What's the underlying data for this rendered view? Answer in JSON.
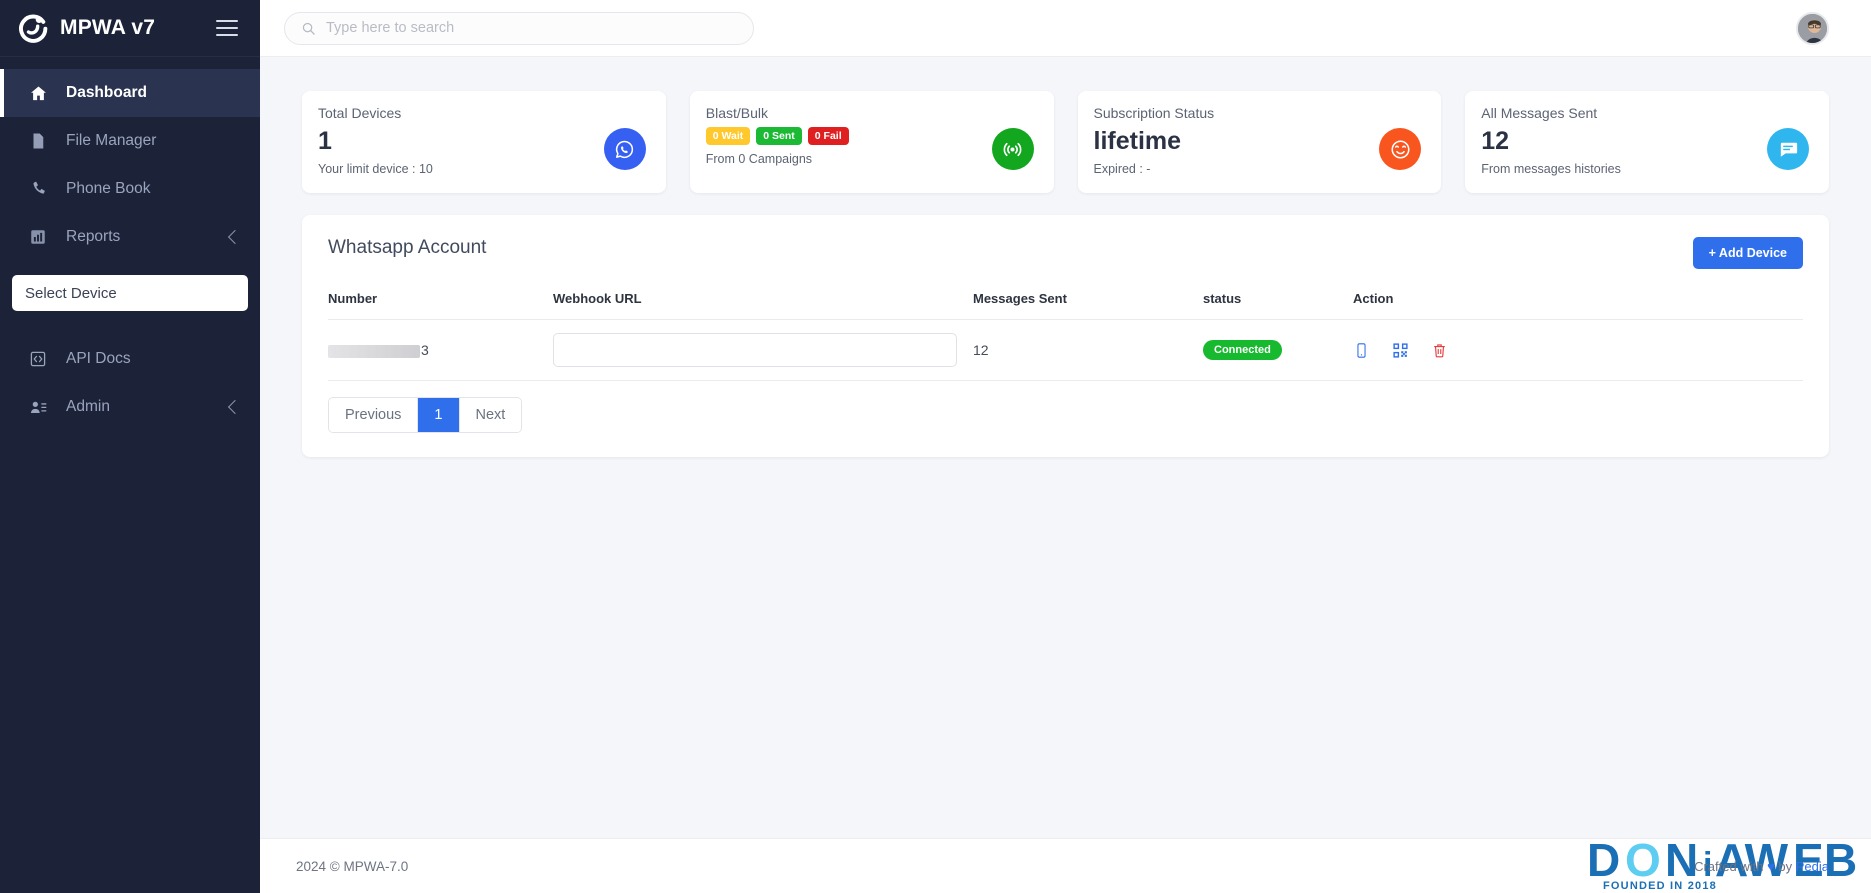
{
  "brand": {
    "name": "MPWA v7",
    "logo_icon": "mpwa-logo-icon",
    "menu_icon": "hamburger-icon"
  },
  "sidebar": {
    "items": [
      {
        "label": "Dashboard",
        "icon": "home-icon",
        "active": true,
        "chevron": false
      },
      {
        "label": "File Manager",
        "icon": "file-icon",
        "active": false,
        "chevron": false
      },
      {
        "label": "Phone Book",
        "icon": "phone-icon",
        "active": false,
        "chevron": false
      },
      {
        "label": "Reports",
        "icon": "bar-chart-icon",
        "active": false,
        "chevron": true
      }
    ],
    "device_select": {
      "label": "Select Device"
    },
    "items_bottom": [
      {
        "label": "API Docs",
        "icon": "code-brackets-icon",
        "active": false,
        "chevron": false
      },
      {
        "label": "Admin",
        "icon": "user-list-icon",
        "active": false,
        "chevron": true
      }
    ]
  },
  "search": {
    "placeholder": "Type here to search",
    "value": "",
    "icon": "search-icon"
  },
  "profile": {
    "avatar_icon": "user-avatar"
  },
  "cards": [
    {
      "title": "Total Devices",
      "value": "1",
      "sub": "Your limit device : 10",
      "icon": "whatsapp-icon",
      "color": "#3560f2"
    },
    {
      "title": "Blast/Bulk",
      "value": "",
      "sub": "From 0 Campaigns",
      "icon": "broadcast-icon",
      "color": "#13a61f",
      "badges": [
        {
          "label": "0 Wait",
          "color": "#ffc82c"
        },
        {
          "label": "0 Sent",
          "color": "#1bb934"
        },
        {
          "label": "0 Fail",
          "color": "#e02020"
        }
      ]
    },
    {
      "title": "Subscription Status",
      "value": "lifetime",
      "sub": "Expired : -",
      "icon": "smiley-icon",
      "color": "#f9551f"
    },
    {
      "title": "All Messages Sent",
      "value": "12",
      "sub": "From messages histories",
      "icon": "chat-icon",
      "color": "#2fb6ef"
    }
  ],
  "panel": {
    "title": "Whatsapp Account",
    "add_button": "+ Add Device",
    "columns": [
      "Number",
      "Webhook URL",
      "Messages Sent",
      "status",
      "Action"
    ],
    "rows": [
      {
        "number_redacted": true,
        "number_suffix": "3",
        "webhook_value": "",
        "webhook_placeholder": "",
        "messages_sent": "12",
        "status": "Connected",
        "status_color": "#17b92e",
        "actions": [
          "mobile-icon",
          "qr-code-icon",
          "trash-icon"
        ]
      }
    ],
    "pagination": {
      "previous": "Previous",
      "current": "1",
      "next": "Next"
    }
  },
  "footer": {
    "copyright": "2024 © MPWA-7.0",
    "credit_prefix": "Crafted with ",
    "credit_heart": "♥",
    "credit_mid": " by ",
    "credit_brand": "Pedia",
    "watermark": {
      "name": "DONIAWEB",
      "tagline": "FOUNDED IN 2018"
    }
  }
}
